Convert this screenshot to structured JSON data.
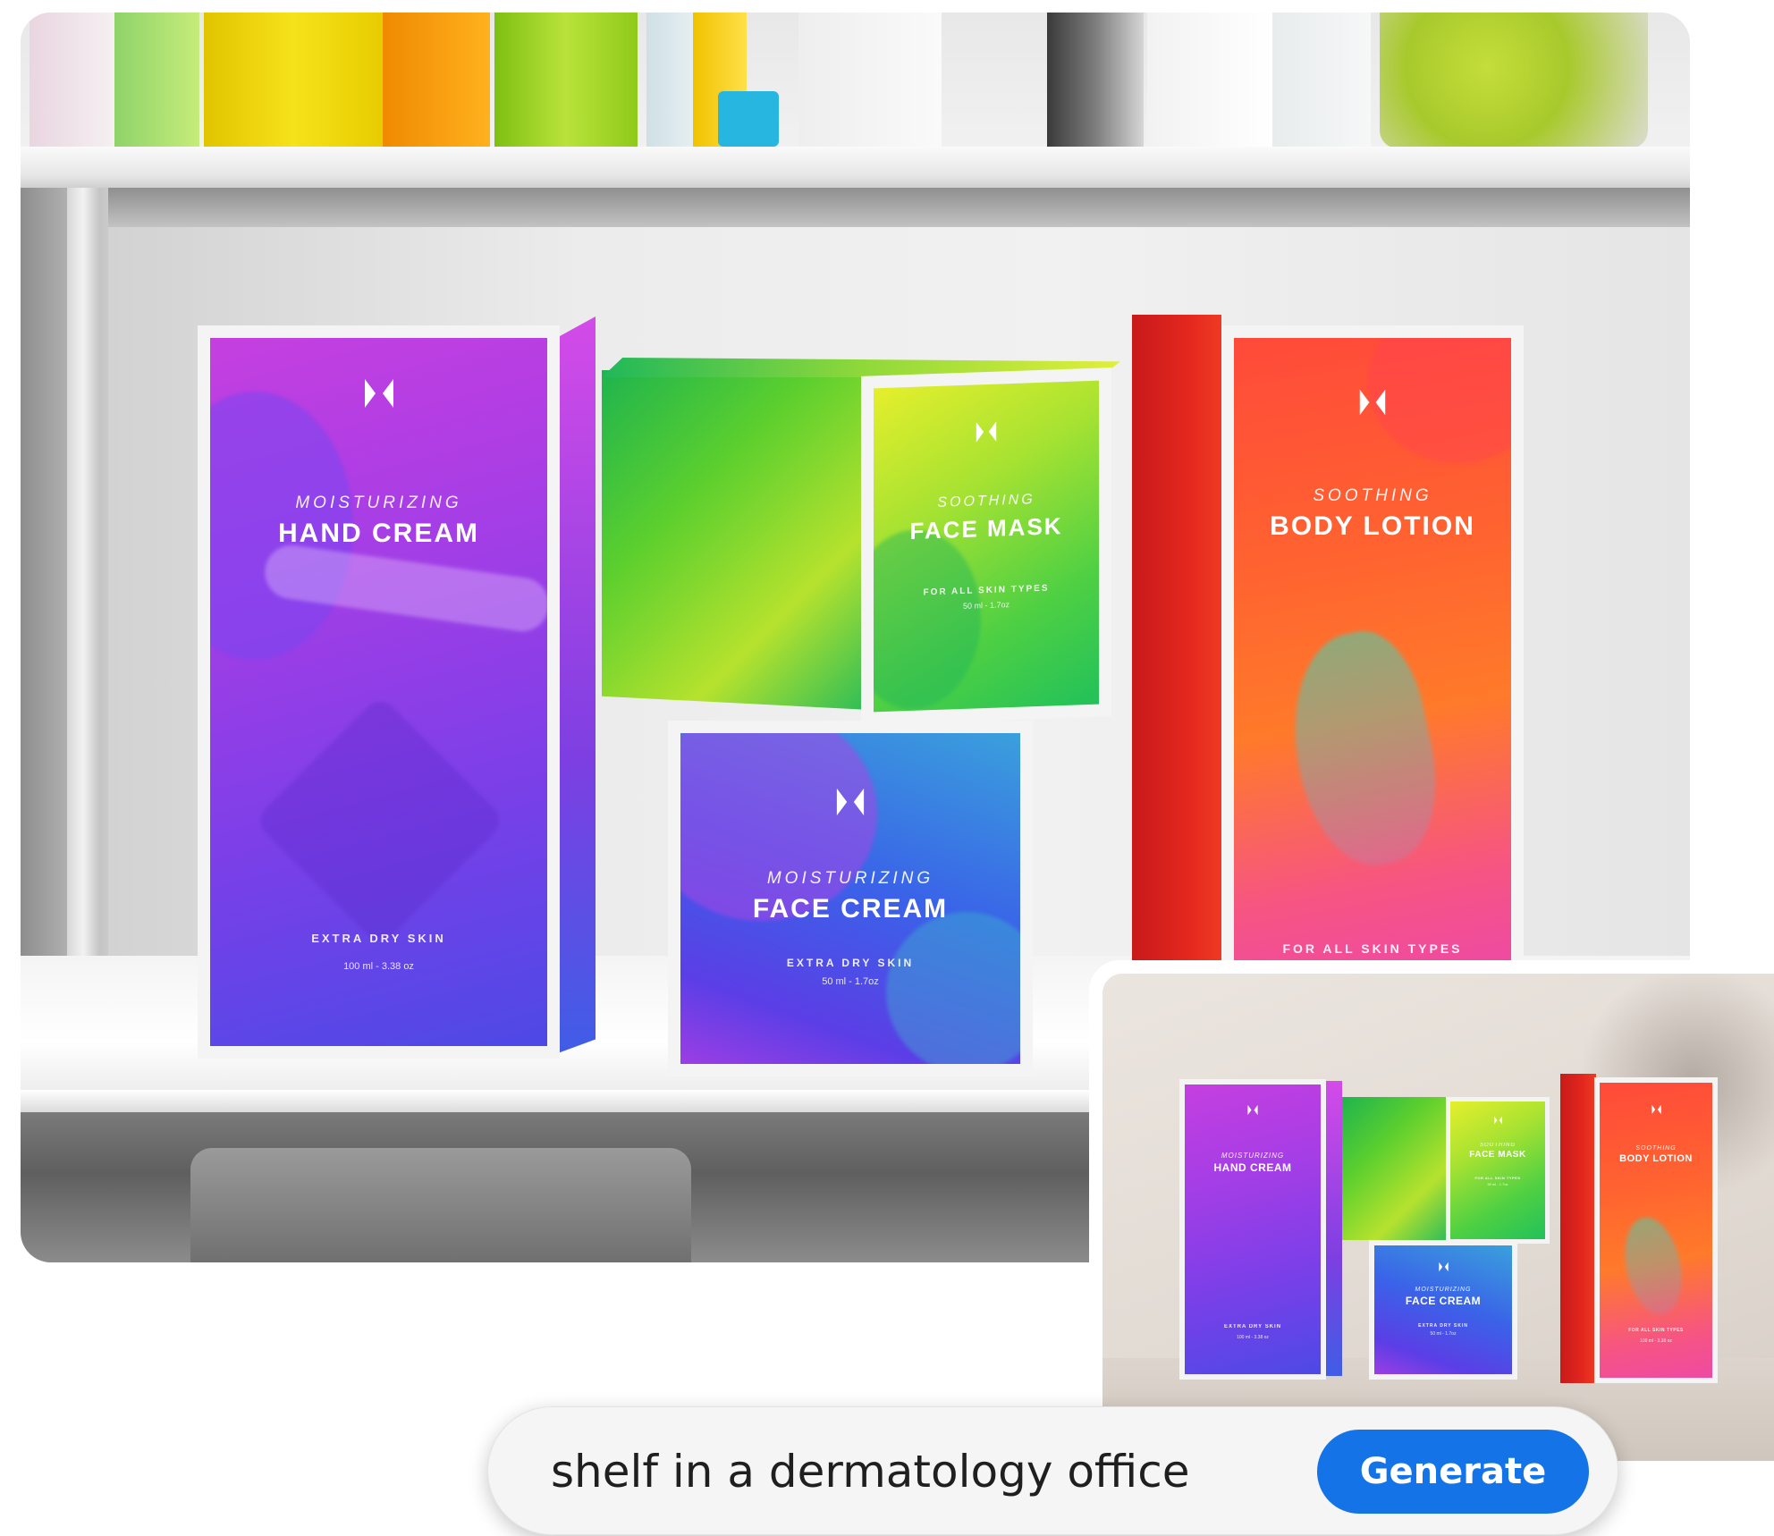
{
  "products": {
    "hand_cream": {
      "subtitle": "MOISTURIZING",
      "title": "HAND CREAM",
      "footer": "EXTRA DRY SKIN",
      "size": "100 ml - 3.38 oz"
    },
    "face_mask": {
      "subtitle": "SOOTHING",
      "title": "FACE MASK",
      "footer": "FOR ALL SKIN TYPES",
      "size": "50 ml - 1.7oz"
    },
    "face_cream": {
      "subtitle": "MOISTURIZING",
      "title": "FACE CREAM",
      "footer": "EXTRA DRY SKIN",
      "size": "50 ml - 1.7oz"
    },
    "body_lotion": {
      "subtitle": "SOOTHING",
      "title": "BODY LOTION",
      "footer": "FOR ALL SKIN TYPES"
    }
  },
  "thumbnail_products": {
    "hand_cream": {
      "subtitle": "MOISTURIZING",
      "title": "HAND CREAM",
      "footer": "EXTRA DRY SKIN",
      "size": "100 ml - 3.38 oz"
    },
    "face_mask": {
      "subtitle": "SOOTHING",
      "title": "FACE MASK",
      "footer": "FOR ALL SKIN TYPES",
      "size": "50 ml - 1.7oz"
    },
    "face_cream": {
      "subtitle": "MOISTURIZING",
      "title": "FACE CREAM",
      "footer": "EXTRA DRY SKIN",
      "size": "50 ml - 1.7oz"
    },
    "body_lotion": {
      "subtitle": "SOOTHING",
      "title": "BODY LOTION",
      "footer": "FOR ALL SKIN TYPES",
      "size": "100 ml - 3.38 oz"
    }
  },
  "prompt": {
    "value": "shelf in a dermatology office",
    "generate_label": "Generate"
  },
  "colors": {
    "generate_button": "#1473e6",
    "hand_cream": [
      "#c33de0",
      "#7b3ee8",
      "#4a46e8"
    ],
    "face_mask": [
      "#d7ee2a",
      "#6fd63a",
      "#1fbf5a"
    ],
    "face_cream": [
      "#9a3fe6",
      "#3b5be8",
      "#2c8ee0"
    ],
    "body_lotion": [
      "#ff5a3c",
      "#ff7a2a",
      "#f24ba0"
    ]
  },
  "icons": [
    "brand-logo-icon"
  ]
}
